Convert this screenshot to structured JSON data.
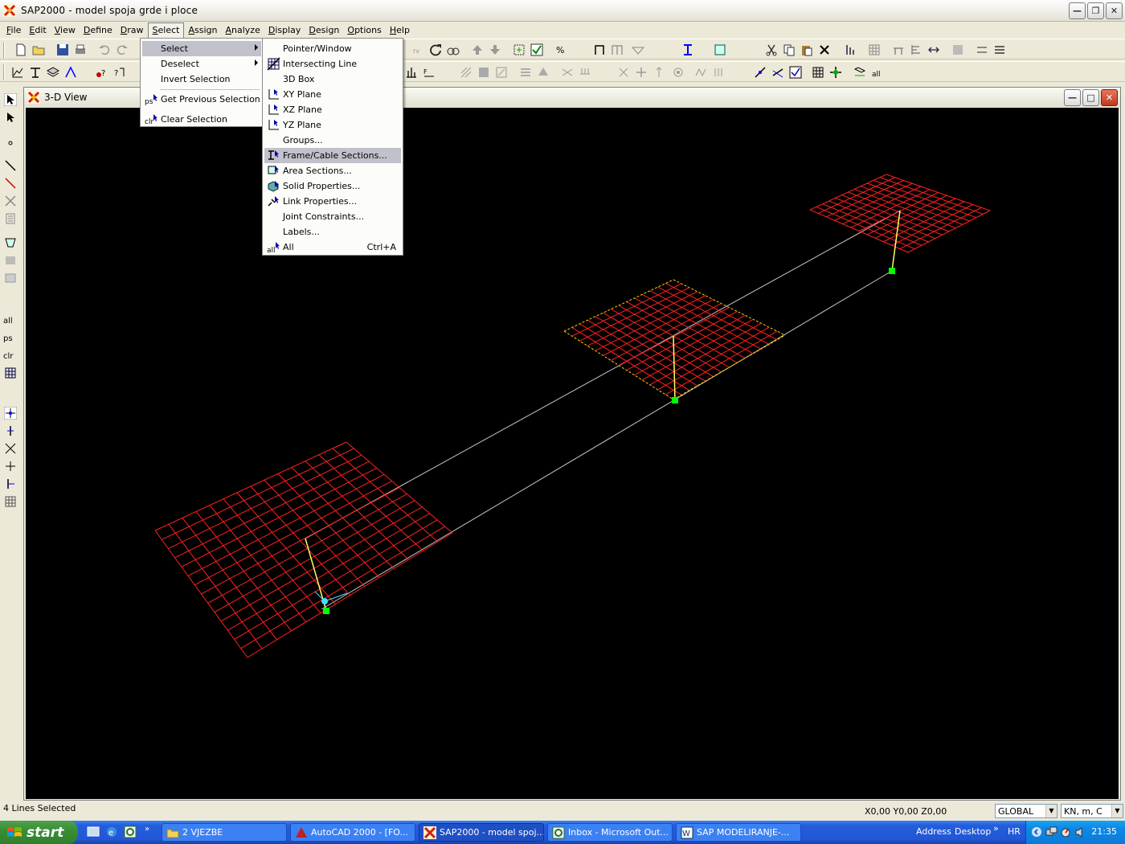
{
  "app": {
    "title": "SAP2000 - model spoja grde i ploce"
  },
  "menubar": {
    "items": [
      {
        "label": "File",
        "u": "F",
        "rest": "ile"
      },
      {
        "label": "Edit",
        "u": "E",
        "rest": "dit"
      },
      {
        "label": "View",
        "u": "V",
        "rest": "iew"
      },
      {
        "label": "Define",
        "u": "D",
        "rest": "efine"
      },
      {
        "label": "Draw",
        "u": "D",
        "rest": "raw"
      },
      {
        "label": "Select",
        "u": "S",
        "rest": "elect"
      },
      {
        "label": "Assign",
        "u": "A",
        "rest": "ssign"
      },
      {
        "label": "Analyze",
        "u": "A",
        "rest": "nalyze"
      },
      {
        "label": "Display",
        "u": "D",
        "rest": "isplay"
      },
      {
        "label": "Design",
        "u": "D",
        "rest": "esign"
      },
      {
        "label": "Options",
        "u": "O",
        "rest": "ptions"
      },
      {
        "label": "Help",
        "u": "H",
        "rest": "elp"
      }
    ]
  },
  "select_menu": {
    "items": [
      {
        "label": "Select",
        "highlighted": true,
        "submenu": true
      },
      {
        "label": "Deselect",
        "submenu": true
      },
      {
        "label": "Invert Selection"
      },
      {
        "label": "Get Previous Selection",
        "icon": "ps"
      },
      {
        "label": "Clear Selection",
        "icon": "clr"
      }
    ]
  },
  "select_submenu": {
    "items": [
      {
        "label": "Pointer/Window"
      },
      {
        "label": "Intersecting Line"
      },
      {
        "label": "3D Box"
      },
      {
        "label": "XY Plane"
      },
      {
        "label": "XZ Plane"
      },
      {
        "label": "YZ Plane"
      },
      {
        "label": "Groups..."
      },
      {
        "label": "Frame/Cable Sections...",
        "highlighted": true
      },
      {
        "label": "Area Sections..."
      },
      {
        "label": "Solid Properties..."
      },
      {
        "label": "Link Properties..."
      },
      {
        "label": "Joint Constraints..."
      },
      {
        "label": "Labels..."
      },
      {
        "label": "All",
        "shortcut": "Ctrl+A",
        "icon": "all"
      }
    ]
  },
  "left_toolbar_labels": {
    "all": "all",
    "ps": "ps",
    "clr": "clr"
  },
  "document": {
    "title": "3-D View"
  },
  "status": {
    "text": "4 Lines Selected",
    "coords": "X0,00  Y0,00  Z0,00",
    "coord_system": "GLOBAL",
    "units": "KN, m, C"
  },
  "taskbar": {
    "start_label": "start",
    "tasks": [
      {
        "label": "2 VJEZBE",
        "icon": "folder-icon"
      },
      {
        "label": "AutoCAD 2000 - [FO...",
        "icon": "autocad-icon"
      },
      {
        "label": "SAP2000 - model spoj...",
        "icon": "sap-icon",
        "active": true
      },
      {
        "label": "Inbox - Microsoft Out...",
        "icon": "outlook-icon"
      },
      {
        "label": "SAP  MODELIRANJE-...",
        "icon": "word-icon"
      }
    ],
    "address_label": "Address",
    "desktop_label": "Desktop",
    "language": "HR",
    "clock": "21:35"
  },
  "colors": {
    "mesh": "#ff2020",
    "frame": "#c8c8c8",
    "column": "#ffff60",
    "joint": "#00ff00",
    "viewport_bg": "#000000"
  }
}
